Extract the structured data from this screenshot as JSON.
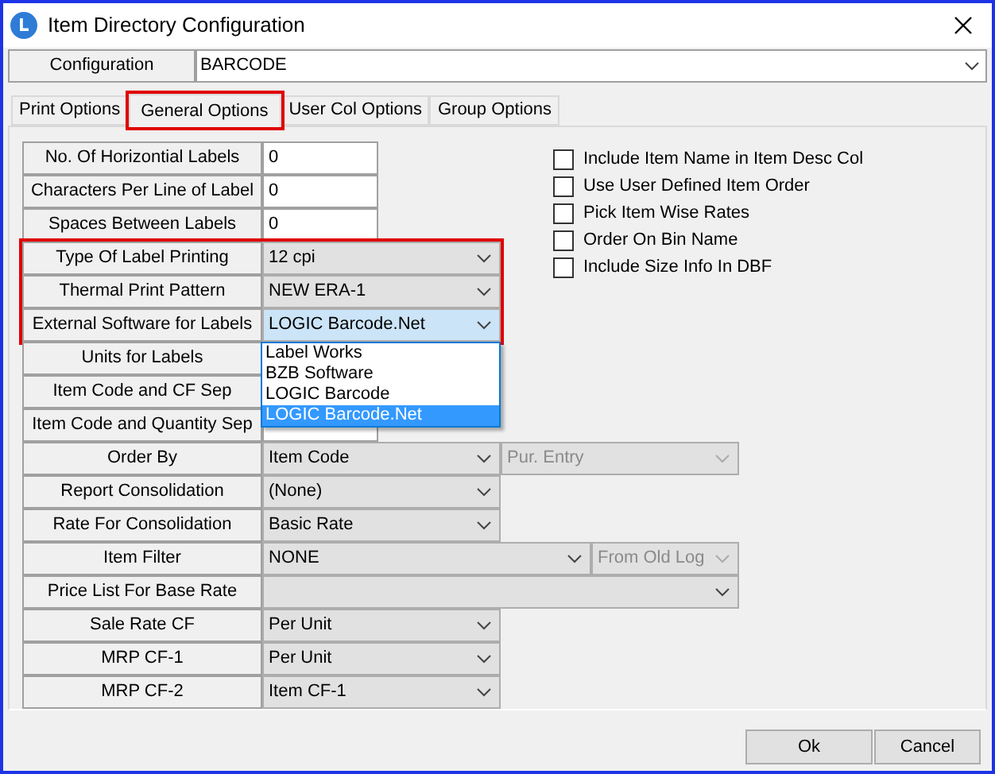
{
  "window": {
    "title": "Item Directory Configuration"
  },
  "configuration": {
    "label": "Configuration",
    "value": "BARCODE"
  },
  "tabs": [
    {
      "label": "Print Options",
      "selected": false,
      "highlighted": false
    },
    {
      "label": "General Options",
      "selected": true,
      "highlighted": true
    },
    {
      "label": "User Col Options",
      "selected": false,
      "highlighted": false
    },
    {
      "label": "Group Options",
      "selected": false,
      "highlighted": false
    }
  ],
  "fields": [
    {
      "label": "No. Of Horizontial Labels",
      "kind": "text",
      "value": "0",
      "highlighted": false
    },
    {
      "label": "Characters Per Line of Label",
      "kind": "text",
      "value": "0",
      "highlighted": false
    },
    {
      "label": "Spaces Between Labels",
      "kind": "text",
      "value": "0",
      "highlighted": false
    },
    {
      "label": "Type Of Label Printing",
      "kind": "combo",
      "value": "12 cpi",
      "highlighted": true,
      "focused": false
    },
    {
      "label": "Thermal Print Pattern",
      "kind": "combo",
      "value": "NEW ERA-1",
      "highlighted": true,
      "focused": false
    },
    {
      "label": "External Software for Labels",
      "kind": "combo",
      "value": "LOGIC Barcode.Net",
      "highlighted": true,
      "focused": true,
      "dropdown": [
        {
          "label": "Label Works",
          "selected": false
        },
        {
          "label": "BZB Software",
          "selected": false
        },
        {
          "label": "LOGIC Barcode",
          "selected": false
        },
        {
          "label": "LOGIC Barcode.Net",
          "selected": true
        }
      ]
    },
    {
      "label": "Units for Labels",
      "kind": "text",
      "highlighted": false
    },
    {
      "label": "Item Code  and CF Sep",
      "kind": "text",
      "highlighted": false
    },
    {
      "label": "Item Code  and Quantity Sep",
      "kind": "text",
      "highlighted": false
    },
    {
      "label": "Order By",
      "kind": "combo",
      "value": "Item Code",
      "highlighted": false,
      "focused": false,
      "secondary": {
        "value": "Pur. Entry",
        "disabled": true
      }
    },
    {
      "label": "Report Consolidation",
      "kind": "combo",
      "value": "(None)",
      "highlighted": false,
      "focused": false
    },
    {
      "label": "Rate For Consolidation",
      "kind": "combo",
      "value": "Basic Rate",
      "highlighted": false,
      "focused": false
    },
    {
      "label": "Item Filter",
      "kind": "split",
      "value": "NONE",
      "highlighted": false,
      "focused": false,
      "secondary": {
        "value": "From Old Log",
        "disabled": true
      }
    },
    {
      "label": "Price List For Base Rate",
      "kind": "wide",
      "highlighted": false,
      "focused": false
    },
    {
      "label": "Sale Rate CF",
      "kind": "combo",
      "value": "Per Unit",
      "highlighted": false,
      "focused": false
    },
    {
      "label": "MRP CF-1",
      "kind": "combo",
      "value": "Per Unit",
      "highlighted": false,
      "focused": false
    },
    {
      "label": "MRP CF-2",
      "kind": "combo",
      "value": "Item CF-1",
      "highlighted": false,
      "focused": false
    }
  ],
  "options": [
    {
      "label": "Include Item Name in Item Desc Col",
      "checked": false
    },
    {
      "label": "Use User Defined Item Order",
      "checked": false
    },
    {
      "label": "Pick Item Wise Rates",
      "checked": false
    },
    {
      "label": "Order On Bin Name",
      "checked": false
    },
    {
      "label": "Include Size Info In DBF",
      "checked": false
    }
  ],
  "buttons": [
    {
      "label": "Ok"
    },
    {
      "label": "Cancel"
    }
  ]
}
